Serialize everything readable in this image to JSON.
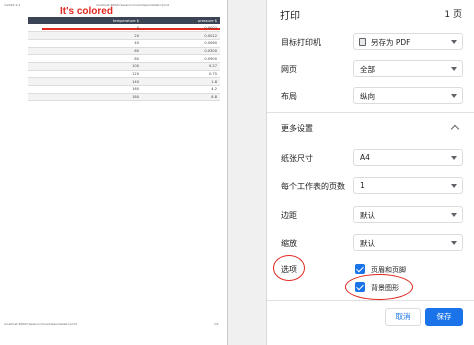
{
  "preview": {
    "header_date": "1/2024 2:1",
    "header_title": "localhost:3000/?session=loremIpsum&tab=print",
    "annotation_text": "It's colored",
    "table": {
      "columns": [
        "temperature $",
        "pressure $"
      ],
      "rows": [
        [
          "0",
          "0.0002"
        ],
        [
          "20",
          "0.0012"
        ],
        [
          "40",
          "0.0060"
        ],
        [
          "60",
          "0.0300"
        ],
        [
          "80",
          "0.0900"
        ],
        [
          "100",
          "0.27"
        ],
        [
          "120",
          "0.75"
        ],
        [
          "140",
          "1.8"
        ],
        [
          "160",
          "4.2"
        ],
        [
          "180",
          "8.8"
        ]
      ]
    },
    "footer_url": "localhost:3000/?session=loremIpsum&tab=print",
    "footer_page": "1/1"
  },
  "panel": {
    "title": "打印",
    "pages": "1 页",
    "destination": {
      "label": "目标打印机",
      "value": "另存为 PDF"
    },
    "pages_setting": {
      "label": "网页",
      "value": "全部"
    },
    "layout": {
      "label": "布局",
      "value": "纵向"
    },
    "more_settings": "更多设置",
    "paper_size": {
      "label": "纸张尺寸",
      "value": "A4"
    },
    "pages_per_sheet": {
      "label": "每个工作表的页数",
      "value": "1"
    },
    "margins": {
      "label": "边距",
      "value": "默认"
    },
    "scale": {
      "label": "缩放",
      "value": "默认"
    },
    "options": {
      "label": "选项",
      "headers_footers": "页眉和页脚",
      "background_graphics": "背景图形"
    },
    "cancel": "取消",
    "save": "保存"
  },
  "colors": {
    "accent": "#1a73e8",
    "annotation": "#e0281e",
    "table_header": "#3b4455"
  }
}
